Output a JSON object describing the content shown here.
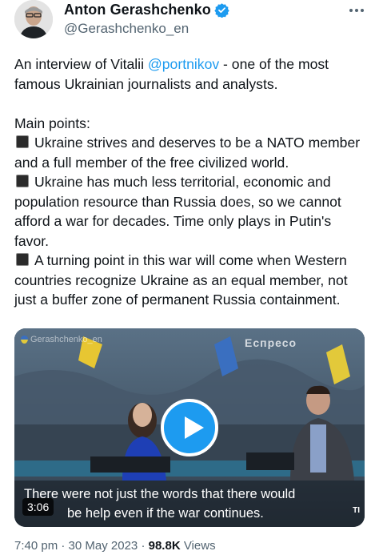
{
  "author": {
    "display_name": "Anton Gerashchenko",
    "handle": "@Gerashchenko_en",
    "verified": true,
    "avatar_icon": "person-avatar"
  },
  "tweet": {
    "intro_before": "An interview of Vitalii ",
    "mention": "@portnikov",
    "intro_after": " - one of the most famous Ukrainian journalists and analysts.",
    "main_points_label": "Main points:",
    "points": [
      "Ukraine strives and deserves to be a NATO member and a full member of the free civilized world.",
      "Ukraine has much less territorial, economic and population resource than Russia does, so we cannot afford a war for decades. Time only plays in Putin's favor.",
      "A turning point in this war will come when Western countries recognize Ukraine as an equal member, not just a buffer zone of permanent Russia containment."
    ],
    "bullet_icon": "black-square-icon"
  },
  "media": {
    "watermark": "Gerashchenko_en",
    "channel_logo": "Еспресо",
    "subtitle_line1": "There were not just the words that there would",
    "subtitle_line2": "be help even if the war continues.",
    "duration": "3:06",
    "corner_text": "TI"
  },
  "meta": {
    "time": "7:40 pm",
    "separator": "·",
    "date": "30 May 2023",
    "views_count": "98.8K",
    "views_label": "Views"
  },
  "colors": {
    "accent": "#1d9bf0",
    "text": "#0f1419",
    "secondary": "#536471"
  }
}
